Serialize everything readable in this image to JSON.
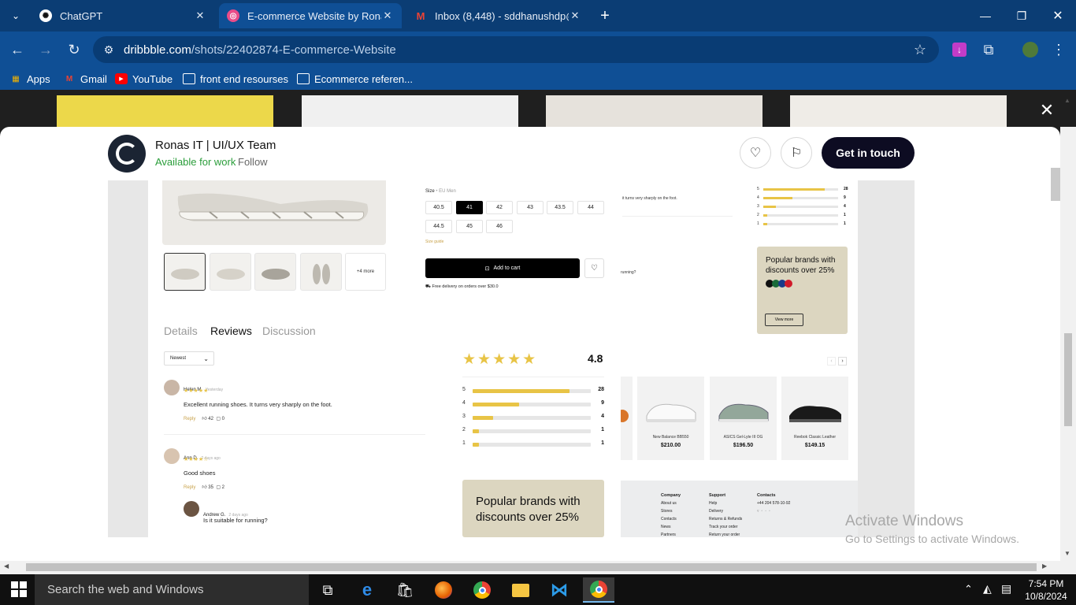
{
  "browser": {
    "tabs": [
      {
        "title": "ChatGPT",
        "icon": "chatgpt-icon",
        "close": "✕"
      },
      {
        "title": "E-commerce Website by Ronas",
        "icon": "dribbble-icon",
        "close": "✕"
      },
      {
        "title": "Inbox (8,448) - sddhanushdp@",
        "icon": "gmail-icon",
        "close": "✕"
      }
    ],
    "new_tab": "+",
    "url_host": "dribbble.com",
    "url_path": "/shots/22402874-E-commerce-Website",
    "bookmarks": [
      "Apps",
      "Gmail",
      "YouTube",
      "front end resourses",
      "Ecommerce referen..."
    ]
  },
  "header": {
    "designer": "Ronas IT | UI/UX Team",
    "availability": "Available for work",
    "follow": "Follow",
    "cta": "Get in touch",
    "close": "✕"
  },
  "product": {
    "size_label": "Size",
    "size_system": "EU Men",
    "sizes": [
      "40.5",
      "41",
      "42",
      "43",
      "43.5",
      "44",
      "44.5",
      "45",
      "46"
    ],
    "size_guide": "Size guide",
    "add_to_cart": "Add to cart",
    "delivery": "Free delivery on orders over $30.0",
    "more_thumbs": "+4 more",
    "tabs": [
      "Details",
      "Reviews",
      "Discussion"
    ],
    "sort": "Newest"
  },
  "reviews": [
    {
      "name": "Helen M.",
      "when": "Yesterday",
      "stars": "★★★★★",
      "text": "Excellent running shoes. It turns very sharply on the foot.",
      "reply": "Reply",
      "likes": "42",
      "comments": "0"
    },
    {
      "name": "Ann D.",
      "when": "2 days ago",
      "stars": "★★★★☆",
      "text": "Good shoes",
      "reply": "Reply",
      "likes": "35",
      "comments": "2"
    },
    {
      "name": "Andrew G.",
      "when": "2 days ago",
      "text": "Is it suitable for running?"
    }
  ],
  "rating": {
    "score": "4.8",
    "rows": [
      {
        "label": "5",
        "count": "28",
        "fraction": 0.82
      },
      {
        "label": "4",
        "count": "9",
        "fraction": 0.39
      },
      {
        "label": "3",
        "count": "4",
        "fraction": 0.17
      },
      {
        "label": "2",
        "count": "1",
        "fraction": 0.05
      },
      {
        "label": "1",
        "count": "1",
        "fraction": 0.05
      }
    ]
  },
  "promo": {
    "text": "Popular brands with discounts over 25%",
    "button": "View more"
  },
  "right_panel": {
    "review_snippet": "it turns very sharply on the foot.",
    "question_snippet": "running?",
    "rating_rows": [
      {
        "label": "5",
        "count": "28",
        "fraction": 0.82
      },
      {
        "label": "4",
        "count": "9",
        "fraction": 0.39
      },
      {
        "label": "3",
        "count": "4",
        "fraction": 0.17
      },
      {
        "label": "2",
        "count": "1",
        "fraction": 0.05
      },
      {
        "label": "1",
        "count": "1",
        "fraction": 0.05
      }
    ],
    "products": [
      {
        "name": "New Balance BB550",
        "price": "$210.00"
      },
      {
        "name": "ASICS Gel-Lyte III OG",
        "price": "$196.50"
      },
      {
        "name": "Reebok Classic Leather",
        "price": "$149.15"
      }
    ],
    "footer": {
      "company": "Company",
      "company_links": [
        "About us",
        "Stores",
        "Contacts",
        "News",
        "Partners"
      ],
      "support": "Support",
      "support_links": [
        "Help",
        "Delivery",
        "Returns & Refunds",
        "Track your order",
        "Return your order"
      ],
      "contacts": "Contacts",
      "phone": "+44 204 578-10-92"
    }
  },
  "watermark": {
    "line1": "Activate Windows",
    "line2": "Go to Settings to activate Windows."
  },
  "taskbar": {
    "search": "Search the web and Windows",
    "time": "7:54 PM",
    "date": "10/8/2024"
  },
  "colors": {
    "accent": "#0d0c22",
    "star": "#e8c446",
    "available": "#2a9d3a"
  }
}
